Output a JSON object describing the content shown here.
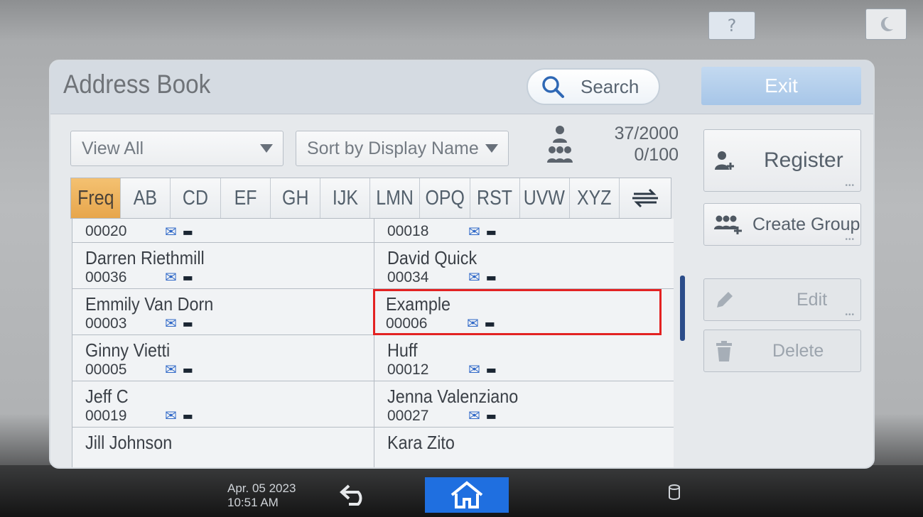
{
  "header": {
    "title": "Address Book",
    "search_label": "Search",
    "exit_label": "Exit",
    "help_label": "?"
  },
  "filters": {
    "view": "View All",
    "sort": "Sort by Display Name"
  },
  "counts": {
    "users": "37/2000",
    "groups": "0/100"
  },
  "tabs": [
    "Freq",
    "AB",
    "CD",
    "EF",
    "GH",
    "IJK",
    "LMN",
    "OPQ",
    "RST",
    "UVW",
    "XYZ"
  ],
  "active_tab": "Freq",
  "entries_left": [
    {
      "name": "",
      "num": "00020"
    },
    {
      "name": "Darren Riethmill",
      "num": "00036"
    },
    {
      "name": "Emmily Van Dorn",
      "num": "00003"
    },
    {
      "name": "Ginny Vietti",
      "num": "00005"
    },
    {
      "name": "Jeff C",
      "num": "00019"
    },
    {
      "name": "Jill Johnson",
      "num": ""
    }
  ],
  "entries_right": [
    {
      "name": "",
      "num": "00018"
    },
    {
      "name": "David Quick",
      "num": "00034"
    },
    {
      "name": "Example",
      "num": "00006"
    },
    {
      "name": "Huff",
      "num": "00012"
    },
    {
      "name": "Jenna Valenziano",
      "num": "00027"
    },
    {
      "name": "Kara Zito",
      "num": ""
    }
  ],
  "highlighted_entry": "Example",
  "actions": {
    "register": "Register",
    "create_group": "Create Group",
    "edit": "Edit",
    "delete": "Delete"
  },
  "status": {
    "date": "Apr. 05 2023",
    "time": "10:51 AM"
  },
  "colors": {
    "active_tab": "#e7a64c",
    "home_button": "#1f6fe0",
    "highlight": "#e32222",
    "exit_button": "#a7c6e8"
  }
}
